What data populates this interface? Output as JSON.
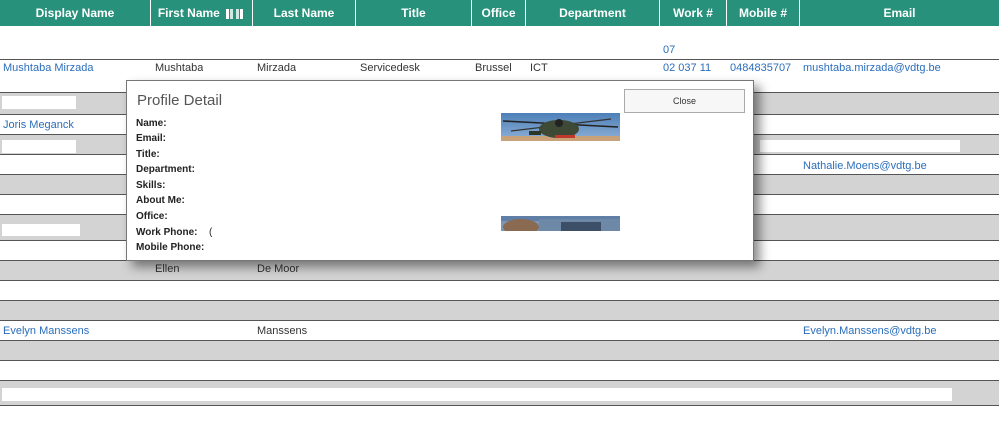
{
  "table": {
    "columns": [
      "Display Name",
      "First Name",
      "Last Name",
      "Title",
      "Office",
      "Department",
      "Work #",
      "Mobile #",
      "Email"
    ],
    "visible_cells": {
      "row1_work": "07",
      "row2_display": "Mushtaba Mirzada",
      "row2_first": "Mushtaba",
      "row2_last": "Mirzada",
      "row2_title": "Servicedesk",
      "row2_office": "Brussel",
      "row2_department": "ICT",
      "row2_work": "02 037 11",
      "row2_mobile": "0484835707",
      "row2_email": "mushtaba.mirzada@vdtg.be",
      "row3_display": "Joris Meganck",
      "row5_email": "Nathalie.Moens@vdtg.be",
      "row11_first": "Ellen",
      "row11_last": "De Moor",
      "row13_display": "Evelyn Manssens",
      "row13_last": "Manssens",
      "row13_email": "Evelyn.Manssens@vdtg.be"
    }
  },
  "modal": {
    "title": "Profile Detail",
    "close_label": "Close",
    "fields": [
      "Name:",
      "Email:",
      "Title:",
      "Department:",
      "Skills:",
      "About Me:",
      "Office:",
      "Work Phone:",
      "Mobile Phone:"
    ],
    "work_phone_fragment": "("
  },
  "colors": {
    "header": "#27917b",
    "alt_row": "#d3d3d3",
    "link": "#2a6ebb"
  },
  "icons": {
    "sort": "sort-arrows-icon"
  }
}
